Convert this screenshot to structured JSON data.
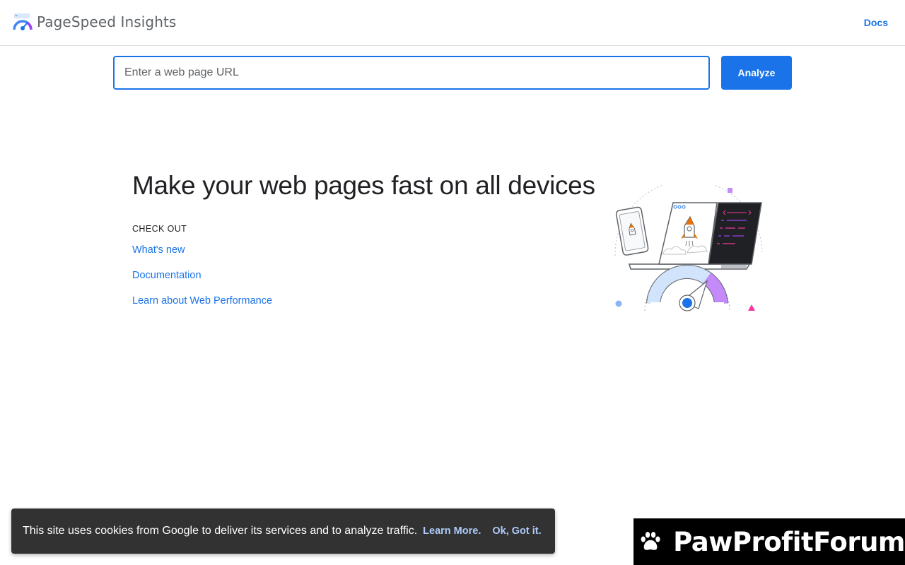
{
  "header": {
    "brand_name": "PageSpeed Insights",
    "docs_label": "Docs"
  },
  "search": {
    "placeholder": "Enter a web page URL",
    "value": "",
    "analyze_label": "Analyze"
  },
  "hero": {
    "title": "Make your web pages fast on all devices",
    "checkout_label": "CHECK OUT",
    "links": [
      {
        "label": "What's new"
      },
      {
        "label": "Documentation"
      },
      {
        "label": "Learn about Web Performance"
      }
    ]
  },
  "cookie_banner": {
    "text": "This site uses cookies from Google to deliver its services and to analyze traffic.",
    "learn_more_label": "Learn More.",
    "ok_label": "Ok, Got it."
  },
  "watermark": {
    "text": "PawProfitForum"
  },
  "colors": {
    "accent": "#1a73e8",
    "banner_bg": "#323232",
    "banner_link": "#aecbfa"
  },
  "icons": {
    "brand": "pagespeed-logo-icon",
    "illustration": "devices-speed-illustration",
    "watermark": "paw-icon"
  }
}
